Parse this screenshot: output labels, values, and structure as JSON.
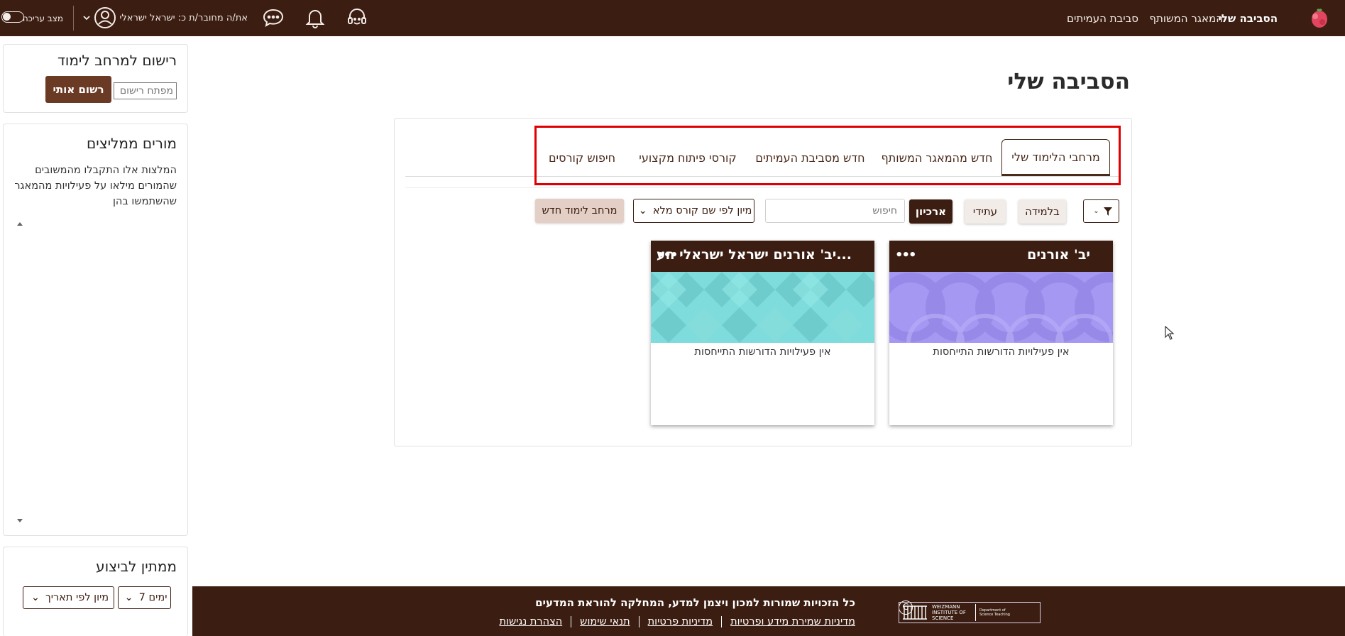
{
  "topnav": {
    "my_environment": "הסביבה שלי",
    "shared_repository": "המאגר המשותף",
    "peer_environment": "סביבת העמיתים",
    "connected_as": "את/ה מחובר/ת כ: ישראל ישראלי",
    "edit_mode": "מצב עריכה"
  },
  "sidebar": {
    "register": {
      "title": "רישום למרחב לימוד",
      "key_placeholder": "מפתח רישום",
      "register_button": "רשום אותי"
    },
    "recommending": {
      "title": "מורים ממליצים",
      "description": "המלצות אלו התקבלו מהמשובים שהמורים מילאו על פעילויות מהמאגר שהשתמשו בהן"
    },
    "pending": {
      "title": "ממתין לביצוע",
      "days_select": "7 ימים",
      "sort_select": "מיון לפי תאריך"
    }
  },
  "main": {
    "title": "הסביבה שלי",
    "tabs": [
      {
        "label": "מרחבי הלימוד שלי"
      },
      {
        "label": "חדש מהמאגר המשותף"
      },
      {
        "label": "חדש מסביבת העמיתים"
      },
      {
        "label": "קורסי פיתוח מקצועי"
      },
      {
        "label": "חיפוש קורסים"
      }
    ],
    "toolbar": {
      "in_progress": "בלמידה",
      "future": "עתידי",
      "archive": "ארכיון",
      "search_placeholder": "חיפוש",
      "sort_select": "מיון לפי שם קורס מלא",
      "new_space": "מרחב לימוד חדש"
    },
    "courses": [
      {
        "title": "יב' אורנים",
        "status": "אין פעילויות הדורשות התייחסות"
      },
      {
        "title": "יב' אורנים ישראל ישראלי הע...",
        "status": "אין פעילויות הדורשות התייחסות"
      }
    ]
  },
  "footer": {
    "copyright": "כל הזכויות שמורות למכון ויצמן למדע, המחלקה להוראת המדעים",
    "links": [
      "מדיניות שמירת מידע ופרטיות",
      "מדיניות פרטיות",
      "תנאי שימוש",
      "הצהרת נגישות"
    ],
    "logo_text": "WEIZMANN INSTITUTE OF SCIENCE",
    "logo_dept": "Department of Science Teaching"
  },
  "colors": {
    "brand": "#3b1d11",
    "highlight": "#e00000",
    "card_purple": "#a89bf2",
    "card_teal": "#7fdcdc"
  }
}
